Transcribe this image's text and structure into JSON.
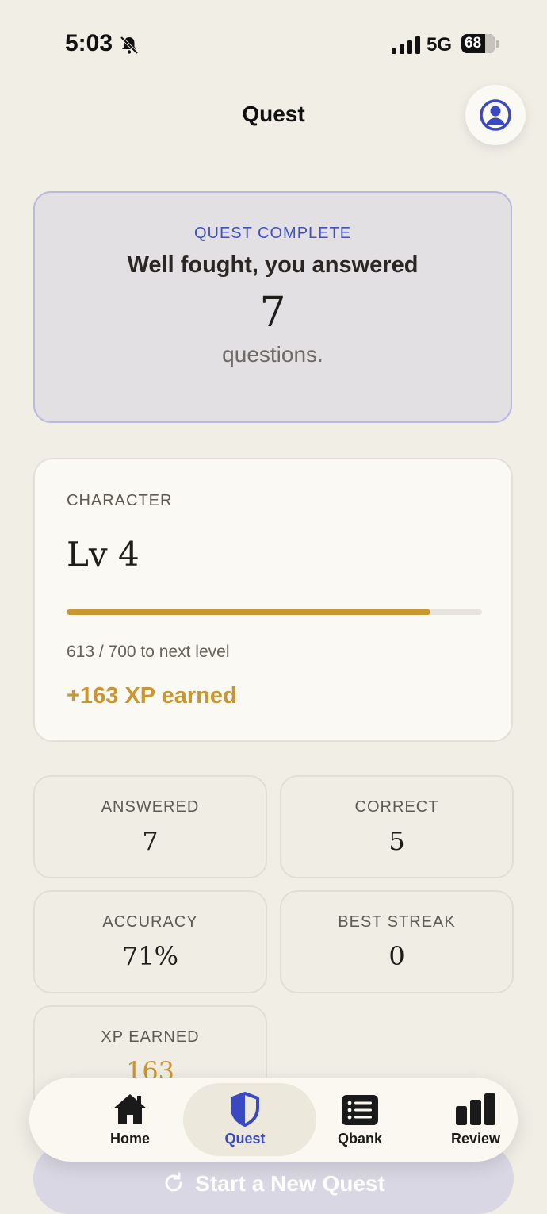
{
  "status_bar": {
    "time": "5:03",
    "network": "5G",
    "battery": "68"
  },
  "header": {
    "title": "Quest"
  },
  "quest_complete": {
    "kicker": "QUEST COMPLETE",
    "message": "Well fought, you answered",
    "count": "7",
    "unit": "questions."
  },
  "character": {
    "label": "CHARACTER",
    "level": "Lv 4",
    "xp_current": 613,
    "xp_goal": 700,
    "progress_fraction": 0.876,
    "progress_text": "613 / 700 to next level",
    "earned_text": "+163 XP earned",
    "accent_color": "#c9962f"
  },
  "stats": [
    {
      "label": "ANSWERED",
      "value": "7"
    },
    {
      "label": "CORRECT",
      "value": "5"
    },
    {
      "label": "ACCURACY",
      "value": "71%"
    },
    {
      "label": "BEST STREAK",
      "value": "0"
    },
    {
      "label": "XP EARNED",
      "value": "163"
    }
  ],
  "start_button": {
    "label": "Start a New Quest"
  },
  "nav": {
    "items": [
      {
        "label": "Home",
        "icon": "home-icon"
      },
      {
        "label": "Quest",
        "icon": "shield-icon",
        "active": true
      },
      {
        "label": "Qbank",
        "icon": "list-icon"
      },
      {
        "label": "Review",
        "icon": "bar-chart-icon"
      }
    ],
    "active_color": "#3a48c2"
  }
}
